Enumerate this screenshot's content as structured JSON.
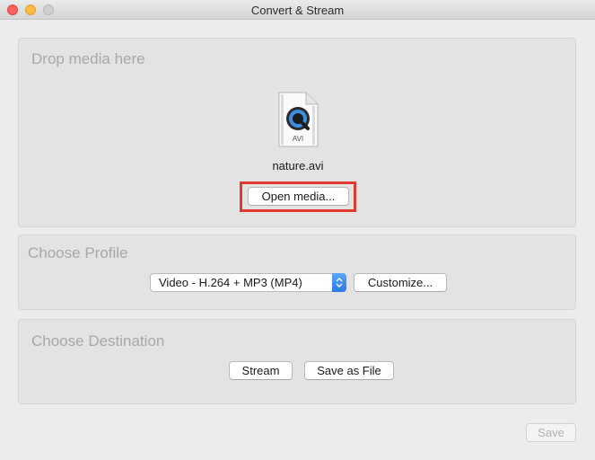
{
  "window": {
    "title": "Convert & Stream"
  },
  "drop_panel": {
    "heading": "Drop media here",
    "file_icon_label": "AVI",
    "file_name": "nature.avi",
    "open_media_label": "Open media..."
  },
  "profile_panel": {
    "heading": "Choose Profile",
    "selected_profile": "Video - H.264 + MP3 (MP4)",
    "customize_label": "Customize..."
  },
  "destination_panel": {
    "heading": "Choose Destination",
    "stream_label": "Stream",
    "save_as_file_label": "Save as File"
  },
  "footer": {
    "save_label": "Save"
  },
  "icons": {
    "file": "quicktime-file-icon",
    "select_arrow": "up-down-chevron-icon"
  },
  "colors": {
    "highlight": "#e03a2f",
    "select_accent": "#2a79e6"
  }
}
